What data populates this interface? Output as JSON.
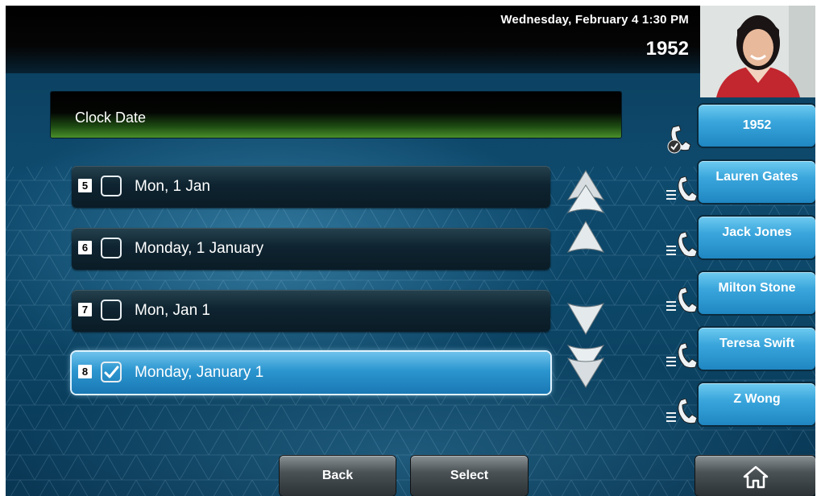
{
  "status": {
    "datetime": "Wednesday, February 4  1:30 PM",
    "extension": "1952"
  },
  "panel": {
    "title": "Clock Date"
  },
  "options": [
    {
      "number": "5",
      "label": "Mon, 1 Jan",
      "checked": false
    },
    {
      "number": "6",
      "label": "Monday, 1 January",
      "checked": false
    },
    {
      "number": "7",
      "label": "Mon, Jan 1",
      "checked": false
    },
    {
      "number": "8",
      "label": "Monday, January 1",
      "checked": true
    }
  ],
  "lines": [
    {
      "label": "1952",
      "icon": "handset-registered-icon"
    },
    {
      "label": "Lauren Gates",
      "icon": "handset-icon"
    },
    {
      "label": "Jack Jones",
      "icon": "handset-icon"
    },
    {
      "label": "Milton Stone",
      "icon": "handset-icon"
    },
    {
      "label": "Teresa Swift",
      "icon": "handset-icon"
    },
    {
      "label": "Z Wong",
      "icon": "handset-icon"
    }
  ],
  "softkeys": {
    "back": "Back",
    "select": "Select",
    "home_icon": "home-icon"
  },
  "colors": {
    "title_green": "#4a8f2a",
    "selected_blue": "#2b95cf",
    "line_blue": "#3aa6dc",
    "background": "#0e4a6d"
  }
}
